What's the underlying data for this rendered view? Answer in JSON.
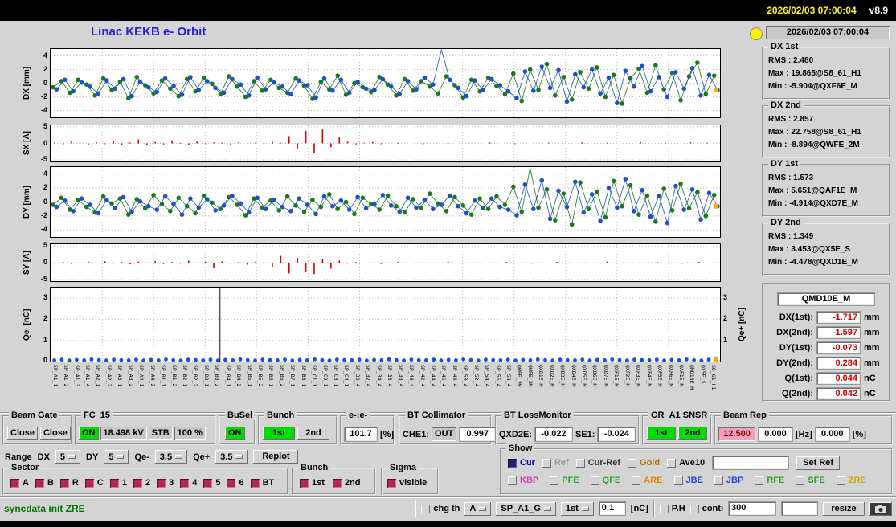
{
  "titlebar": {
    "datetime": "2026/02/03 07:00:04",
    "version": "v8.9"
  },
  "header": {
    "title": "Linac KEKB e- Orbit"
  },
  "stats": {
    "timestamp": "2026/02/03 07:00:04",
    "groups": [
      {
        "name": "DX 1st",
        "rms": "RMS :  2.480",
        "max": "Max :  19.865@S8_61_H1",
        "min": "Min :  -5.904@QXF6E_M"
      },
      {
        "name": "DX 2nd",
        "rms": "RMS :  2.857",
        "max": "Max :  22.758@S8_61_H1",
        "min": "Min :  -8.894@QWFE_2M"
      },
      {
        "name": "DY 1st",
        "rms": "RMS :  1.573",
        "max": "Max :  5.651@QAF1E_M",
        "min": "Min :  -4.914@QXD7E_M"
      },
      {
        "name": "DY 2nd",
        "rms": "RMS :  1.349",
        "max": "Max :  3.453@QX5E_S",
        "min": "Min :  -4.478@QXD1E_M"
      }
    ],
    "monitor": {
      "title": "QMD10E_M",
      "rows": [
        {
          "label": "DX(1st):",
          "value": "-1.717",
          "unit": "mm"
        },
        {
          "label": "DX(2nd):",
          "value": "-1.597",
          "unit": "mm"
        },
        {
          "label": "DY(1st):",
          "value": "-0.073",
          "unit": "mm"
        },
        {
          "label": "DY(2nd):",
          "value": "0.284",
          "unit": "mm"
        },
        {
          "label": "Q(1st):",
          "value": "0.044",
          "unit": "nC"
        },
        {
          "label": "Q(2nd):",
          "value": "0.042",
          "unit": "nC"
        }
      ]
    }
  },
  "chart_data": [
    {
      "id": "dx",
      "type": "scatter-line",
      "ylabel": "DX [mm]",
      "ylim": [
        -5,
        5
      ],
      "yticks": [
        4,
        2,
        0,
        -2,
        -4
      ],
      "series": [
        {
          "name": "1st bunch",
          "color": "#1a7a1a",
          "values": [
            -0.6,
            0.3,
            -1.4,
            0.5,
            -0.2,
            -1.8,
            0.7,
            -1.0,
            0.2,
            -2.2,
            0.9,
            -0.3,
            -1.5,
            0.4,
            -0.8,
            -1.9,
            0.6,
            -1.2,
            0.8,
            -0.1,
            -1.6,
            1.0,
            -0.5,
            -2.0,
            0.3,
            -1.1,
            0.5,
            -0.7,
            -1.4,
            0.7,
            -0.4,
            -2.3,
            0.2,
            -0.9,
            1.1,
            -1.7,
            0.0,
            -0.6,
            -1.3,
            0.9,
            -0.2,
            -1.8,
            0.6,
            -1.1,
            0.3,
            -0.5,
            -1.5,
            1.0,
            -0.3,
            -2.1,
            0.5,
            -1.2,
            0.8,
            -0.4,
            -1.6,
            1.4,
            -2.6,
            2.0,
            -1.0,
            2.8,
            -1.8,
            0.9,
            -2.4,
            1.6,
            -0.8,
            2.3,
            -2.0,
            1.2,
            -3.0,
            0.7,
            2.1,
            -1.4,
            2.6,
            -0.9,
            1.5,
            -2.5,
            1.0,
            3.0,
            -1.6,
            1.1
          ]
        },
        {
          "name": "2nd bunch",
          "color": "#2050c8",
          "values": [
            -0.9,
            0.5,
            -1.2,
            0.1,
            -0.5,
            -1.5,
            0.4,
            -0.8,
            0.6,
            -1.9,
            0.2,
            -0.6,
            -1.3,
            0.7,
            -0.4,
            -1.7,
            0.9,
            -1.0,
            0.3,
            -0.7,
            -1.4,
            0.6,
            -0.2,
            -1.8,
            0.8,
            -0.9,
            0.1,
            -0.5,
            -1.6,
            0.4,
            -0.3,
            -2.1,
            0.7,
            -1.1,
            0.5,
            -1.4,
            0.2,
            -0.8,
            -1.0,
            0.6,
            -0.5,
            -1.6,
            0.3,
            -0.9,
            0.8,
            -0.2,
            19.9,
            0.5,
            -0.7,
            -1.9,
            0.4,
            -1.0,
            0.6,
            -0.3,
            -1.2,
            -2.2,
            1.7,
            -1.1,
            2.4,
            -0.7,
            1.9,
            -2.7,
            1.3,
            -0.6,
            2.0,
            -1.5,
            0.8,
            -2.9,
            1.8,
            -0.5,
            2.5,
            -1.2,
            0.9,
            -2.0,
            1.6,
            -0.8,
            2.2,
            -1.8,
            1.2,
            -1.0
          ]
        }
      ],
      "last_point": -1.0
    },
    {
      "id": "sx",
      "type": "bar",
      "ylabel": "SX [A]",
      "ylim": [
        -5.5,
        5.5
      ],
      "yticks": [
        5,
        0,
        -5
      ],
      "color": "#cc0000",
      "values": [
        0.4,
        -0.3,
        0.6,
        0.2,
        -0.5,
        0.3,
        -0.2,
        0.8,
        -0.4,
        0.3,
        1.2,
        -0.6,
        0.4,
        -0.3,
        0.9,
        0.2,
        -0.4,
        0.5,
        -0.2,
        0.3,
        0.2,
        -0.3,
        0.4,
        0.0,
        0.3,
        -0.2,
        0.5,
        0.2,
        2.2,
        -1.5,
        3.8,
        -2.8,
        4.2,
        -1.2,
        1.8,
        0.5,
        -0.3,
        0.2,
        0.4,
        -0.2,
        0.0,
        0.2,
        0.0,
        0.0,
        -0.3,
        0.0,
        0.0,
        0.2,
        0.0,
        0.0,
        0.0,
        0.0,
        0.3,
        0.0,
        0.0,
        -0.2,
        0.0,
        0.0,
        0.0,
        0.2,
        0.0,
        0.0,
        0.0,
        0.3,
        0.0,
        0.0,
        0.2,
        0.0,
        0.0,
        0.0,
        0.4,
        0.0,
        0.0,
        0.2,
        0.0,
        0.0,
        0.3,
        0.0,
        0.2,
        0.0
      ]
    },
    {
      "id": "dy",
      "type": "scatter-line",
      "ylabel": "DY [mm]",
      "ylim": [
        -5,
        5
      ],
      "yticks": [
        4,
        2,
        0,
        -2,
        -4
      ],
      "series": [
        {
          "name": "1st bunch",
          "color": "#1a7a1a",
          "values": [
            -0.4,
            0.6,
            -1.1,
            0.3,
            -0.7,
            -1.5,
            0.8,
            -0.2,
            0.5,
            -1.8,
            0.4,
            -0.9,
            1.0,
            -0.3,
            -1.3,
            0.6,
            -0.6,
            -1.6,
            0.9,
            -0.1,
            -1.0,
            0.7,
            -0.4,
            -1.9,
            0.5,
            -0.8,
            0.2,
            -1.2,
            0.8,
            -0.5,
            -1.4,
            0.3,
            -0.7,
            1.1,
            -1.0,
            0.0,
            -1.7,
            0.6,
            -0.3,
            -1.1,
            0.9,
            -0.6,
            -1.5,
            0.4,
            -0.8,
            1.2,
            -0.2,
            -1.3,
            0.7,
            -0.5,
            -1.8,
            0.5,
            -1.0,
            0.8,
            -0.4,
            2.2,
            -1.4,
            5.6,
            -0.8,
            1.8,
            -2.6,
            1.2,
            -3.2,
            2.8,
            -1.0,
            1.5,
            -2.2,
            3.0,
            -0.6,
            2.4,
            -1.8,
            0.9,
            -2.8,
            1.9,
            -1.2,
            2.6,
            -0.9,
            1.4,
            -2.0,
            1.0
          ]
        },
        {
          "name": "2nd bunch",
          "color": "#2050c8",
          "values": [
            -0.7,
            0.2,
            -1.3,
            0.5,
            -0.4,
            -1.6,
            0.3,
            -0.9,
            0.7,
            -1.4,
            0.1,
            -0.6,
            -1.1,
            0.8,
            -0.3,
            -1.8,
            0.5,
            -0.8,
            0.4,
            -1.2,
            -0.5,
            0.9,
            -0.2,
            -1.5,
            0.6,
            -1.0,
            0.3,
            -0.7,
            -1.3,
            0.5,
            -0.4,
            -1.7,
            0.8,
            -0.6,
            0.2,
            -1.1,
            0.7,
            -0.9,
            -0.3,
            1.0,
            -0.5,
            -1.4,
            0.6,
            -0.8,
            0.3,
            -1.0,
            -0.4,
            0.9,
            -0.6,
            -1.6,
            0.2,
            -0.9,
            0.5,
            -0.7,
            -1.1,
            -1.9,
            2.5,
            -1.0,
            3.1,
            -2.4,
            1.6,
            -0.7,
            2.9,
            -1.5,
            1.1,
            -2.7,
            2.0,
            -0.8,
            3.3,
            -1.3,
            1.7,
            -2.1,
            0.9,
            -3.0,
            2.3,
            -1.1,
            1.8,
            -2.5,
            1.3,
            -0.6
          ]
        }
      ],
      "last_point": -0.6
    },
    {
      "id": "sy",
      "type": "bar",
      "ylabel": "SY [A]",
      "ylim": [
        -5.5,
        5.5
      ],
      "yticks": [
        5,
        0,
        -5
      ],
      "color": "#cc0000",
      "values": [
        -0.3,
        0.2,
        -0.4,
        0.0,
        0.3,
        -0.2,
        0.4,
        -0.3,
        0.2,
        -0.5,
        0.3,
        -0.2,
        0.5,
        -0.4,
        0.2,
        -0.3,
        0.6,
        -0.2,
        0.3,
        -1.6,
        0.4,
        -0.3,
        0.2,
        -0.6,
        0.3,
        -0.2,
        -1.2,
        2.0,
        -3.2,
        1.4,
        -2.6,
        -3.4,
        1.0,
        -1.8,
        0.6,
        -0.3,
        0.2,
        0.0,
        0.0,
        -0.4,
        0.0,
        0.2,
        0.0,
        0.0,
        -0.2,
        0.0,
        0.0,
        0.3,
        0.0,
        0.0,
        0.0,
        -0.2,
        0.0,
        0.0,
        0.2,
        0.0,
        0.0,
        -0.3,
        0.0,
        0.0,
        0.2,
        0.0,
        0.0,
        0.0,
        -0.2,
        0.0,
        0.3,
        0.0,
        0.0,
        -0.2,
        0.0,
        0.0,
        0.2,
        0.0,
        0.0,
        -0.3,
        0.0,
        0.2,
        0.0,
        -0.2
      ]
    },
    {
      "id": "q",
      "type": "dots",
      "ylabel": "Qe- [nC]",
      "ylabel_right": "Qe+ [nC]",
      "ylim": [
        0,
        3.5
      ],
      "yticks": [
        3,
        2,
        1,
        0
      ],
      "yticks_right": [
        3,
        2,
        1
      ],
      "color": "#2050c8",
      "spike_x": 0.253,
      "last_point": 0.12,
      "values": [
        0.06,
        0.09,
        0.05,
        0.08,
        0.06,
        0.1,
        0.07,
        0.05,
        0.09,
        0.07,
        0.06,
        0.09,
        0.05,
        0.08,
        0.06,
        0.1,
        0.07,
        0.05,
        0.09,
        0.07,
        0.06,
        0.09,
        0.05,
        0.08,
        0.06,
        0.1,
        0.07,
        0.05,
        0.09,
        0.07,
        0.06,
        0.09,
        0.05,
        0.08,
        0.06,
        0.1,
        0.07,
        0.05,
        0.09,
        0.07,
        0.06,
        0.09,
        0.05,
        0.08,
        0.06,
        0.1,
        0.07,
        0.05,
        0.09,
        0.07,
        0.06,
        0.09,
        0.05,
        0.08,
        0.06,
        0.1,
        0.07,
        0.05,
        0.09,
        0.07,
        0.06,
        0.09,
        0.05,
        0.08,
        0.06,
        0.1,
        0.07,
        0.05,
        0.09,
        0.07,
        0.06,
        0.09,
        0.05,
        0.08,
        0.06,
        0.1,
        0.07,
        0.05,
        0.09,
        0.07,
        0.06,
        0.09,
        0.05,
        0.08,
        0.06,
        0.1,
        0.07,
        0.05,
        0.09,
        0.07
      ]
    }
  ],
  "axis_labels": [
    "SP_A1_1",
    "SP_A1_2",
    "SP_A1_3",
    "SP_A1_4",
    "SP_A2_1",
    "SP_A2_2",
    "SP_A3_1",
    "SP_A3_2",
    "SP_A4_1",
    "SP_A4_2",
    "SP_B1_1",
    "SP_B1_2",
    "SP_B2_1",
    "SP_B2_2",
    "SP_B3_1",
    "SP_B3_2",
    "SP_B4_1",
    "SP_B4_2",
    "SP_B5_1",
    "SP_B5_2",
    "SP_B6_1",
    "SP_B6_2",
    "SP_B7_1",
    "SP_B8_1",
    "SP_C1_1",
    "SP_C2_1",
    "SP_C3_1",
    "SP_C4_1",
    "SP_30_4",
    "SP_32_4",
    "SP_34_4",
    "SP_36_4",
    "SP_38_4",
    "SP_40_4",
    "SP_42_4",
    "SP_44_4",
    "SP_46_4",
    "SP_48_4",
    "SP_50_4",
    "SP_52_4",
    "SP_54_4",
    "SP_56_4",
    "SP_58_4",
    "QWFE_2M",
    "QWFE_3M",
    "QXD1E_M",
    "QXD2E_M",
    "QXD3E_M",
    "QXD4E_M",
    "QXD5E_M",
    "QXD6E_M",
    "QXD7E_M",
    "QXF1E_M",
    "QXF2E_M",
    "QXF3E_M",
    "QXF4E_M",
    "QXF5E_M",
    "QXF6E_M",
    "QAF1E_M",
    "QMD10E_M",
    "QX5E_S",
    "S8_61_H1"
  ],
  "controls": {
    "beam_gate": {
      "title": "Beam Gate",
      "close1": "Close",
      "close2": "Close"
    },
    "fc15": {
      "title": "FC_15",
      "on": "ON",
      "kv": "18.498 kV",
      "stb": "STB",
      "pct": "100 %"
    },
    "busel": {
      "title": "BuSel",
      "on": "ON"
    },
    "bunch_top": {
      "title": "Bunch",
      "first": "1st",
      "second": "2nd"
    },
    "ee": {
      "title": "e-:e-",
      "value": "101.7",
      "unit": "[%]"
    },
    "bt_collimator": {
      "title": "BT Collimator",
      "che1_label": "CHE1:",
      "che1_value": "OUT",
      "value2": "0.997"
    },
    "bt_lossmonitor": {
      "title": "BT LossMonitor",
      "l1": "QXD2E:",
      "v1": "-0.022",
      "l2": "SE1:",
      "v2": "-0.024"
    },
    "gr_a1_snsr": {
      "title": "GR_A1 SNSR",
      "first": "1st",
      "second": "2nd"
    },
    "beam_rep": {
      "title": "Beam Rep",
      "v1": "12.500",
      "v2": "0.000",
      "u1": "[Hz]",
      "v3": "0.000",
      "u2": "[%]"
    },
    "range": {
      "label": "Range",
      "dx_label": "DX",
      "dx_value": "5",
      "dy_label": "DY",
      "dy_value": "5",
      "qem_label": "Qe-",
      "qem_value": "3.5",
      "qep_label": "Qe+",
      "qep_value": "3.5",
      "replot": "Replot"
    },
    "sector": {
      "title": "Sector",
      "items": [
        {
          "label": "A",
          "checked": true
        },
        {
          "label": "B",
          "checked": true
        },
        {
          "label": "R",
          "checked": true
        },
        {
          "label": "C",
          "checked": true
        },
        {
          "label": "1",
          "checked": true
        },
        {
          "label": "2",
          "checked": true
        },
        {
          "label": "3",
          "checked": true
        },
        {
          "label": "4",
          "checked": true
        },
        {
          "label": "5",
          "checked": true
        },
        {
          "label": "6",
          "checked": true
        },
        {
          "label": "BT",
          "checked": true
        }
      ]
    },
    "bunch_bottom": {
      "title": "Bunch",
      "items": [
        {
          "label": "1st",
          "checked": true
        },
        {
          "label": "2nd",
          "checked": true
        }
      ]
    },
    "sigma": {
      "title": "Sigma",
      "items": [
        {
          "label": "visible",
          "checked": true
        }
      ]
    },
    "show": {
      "title": "Show",
      "row1": [
        {
          "label": "Cur",
          "color": "#0000cc",
          "checked": true
        },
        {
          "label": "Ref",
          "color": "#999999",
          "checked": false
        },
        {
          "label": "Cur-Ref",
          "color": "#333333",
          "checked": false
        },
        {
          "label": "Gold",
          "color": "#aa7700",
          "checked": false
        },
        {
          "label": "Ave10",
          "color": "#111111",
          "checked": false
        }
      ],
      "ref_input": "",
      "set_ref": "Set Ref",
      "row2": [
        {
          "label": "KBP",
          "color": "#cc44aa",
          "checked": false
        },
        {
          "label": "PFE",
          "color": "#22aa22",
          "checked": false
        },
        {
          "label": "QFE",
          "color": "#22aa22",
          "checked": false
        },
        {
          "label": "ARE",
          "color": "#dd8800",
          "checked": false
        },
        {
          "label": "JBE",
          "color": "#2244dd",
          "checked": false
        },
        {
          "label": "JBP",
          "color": "#2244dd",
          "checked": false
        },
        {
          "label": "RFE",
          "color": "#22aa22",
          "checked": false
        },
        {
          "label": "SFE",
          "color": "#22aa22",
          "checked": false
        },
        {
          "label": "ZRE",
          "color": "#ccaa00",
          "checked": false
        }
      ]
    },
    "statusbar": {
      "message": "syncdata init ZRE",
      "chg_th": {
        "label": "chg th",
        "checked": false
      },
      "mode": "A",
      "monitor": "SP_A1_G",
      "bunch": "1st",
      "threshold": "0.1",
      "unit": "[nC]",
      "ph": {
        "label": "P.H",
        "checked": false
      },
      "conti": {
        "label": "conti",
        "checked": false
      },
      "interval": "300",
      "blank": "",
      "resize": "resize"
    }
  }
}
